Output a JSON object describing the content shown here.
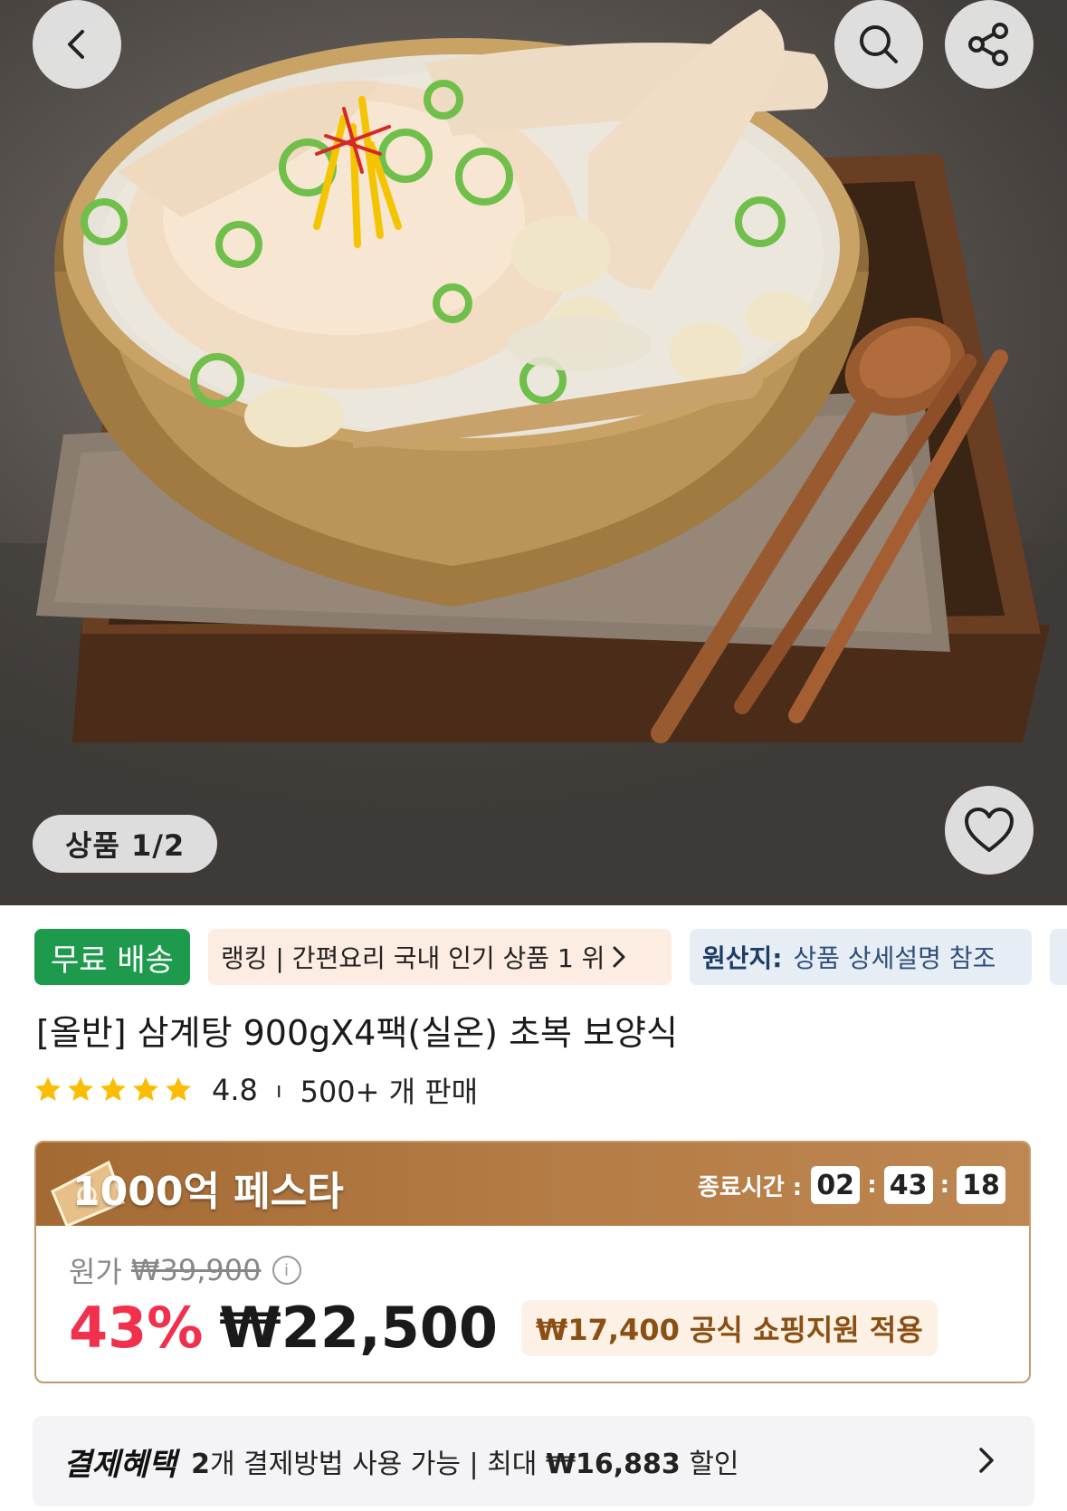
{
  "header": {
    "back_icon": "chevron-left-icon",
    "search_icon": "search-icon",
    "share_icon": "share-icon",
    "wishlist_icon": "heart-icon",
    "image_counter": "상품 1/2"
  },
  "tags": {
    "free_shipping": "무료 배송",
    "ranking": "랭킹 | 간편요리 국내 인기 상품 1 위",
    "origin_label": "원산지:",
    "origin_value": "상품 상세설명 참조"
  },
  "product": {
    "title": "[올반] 삼계탕 900gX4팩(실온) 초복 보양식",
    "rating": "4.8",
    "rating_sep": "ı",
    "sold": "500+ 개 판매",
    "star_count": 5,
    "star_color": "#fbbc05"
  },
  "promo": {
    "title": "1000억 페스타",
    "timer_label": "종료시간 :",
    "timer_hours": "02",
    "timer_minutes": "43",
    "timer_seconds": "18",
    "timer_sep": ":",
    "original_label": "원가",
    "original_price": "₩39,900",
    "discount_pct": "43%",
    "sale_price": "₩22,500",
    "support_text": "₩17,400 공식 쇼핑지원 적용"
  },
  "payment": {
    "label": "결제혜택",
    "count": "2",
    "text_mid": "개 결제방법 사용 가능 | 최대 ",
    "max_amount": "₩16,883",
    "text_end": " 할인"
  },
  "colors": {
    "free_ship_green": "#1e9a4d",
    "discount_red": "#f0304d",
    "promo_brown": "#a36a33"
  }
}
